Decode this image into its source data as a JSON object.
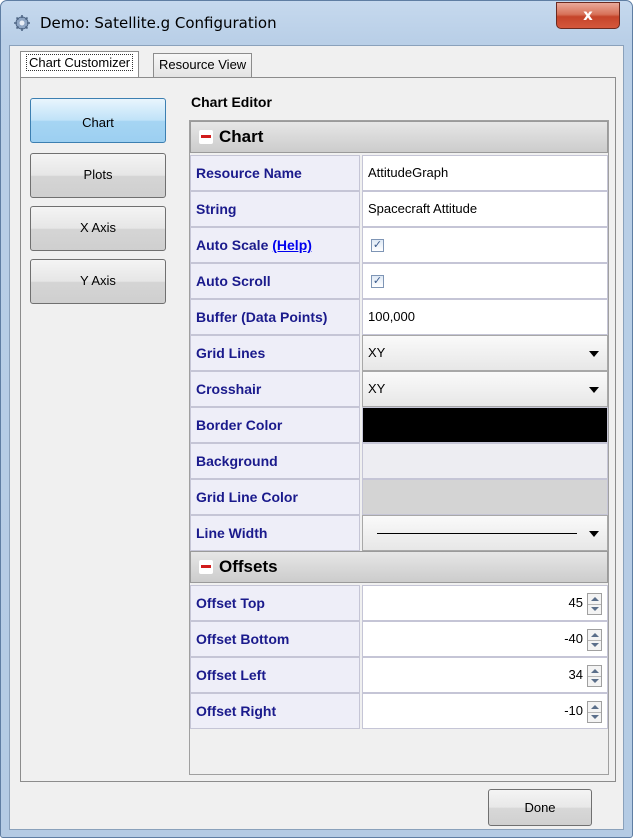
{
  "window": {
    "title": "Demo: Satellite.g Configuration",
    "close_glyph": "x"
  },
  "tabs": [
    {
      "label": "Chart Customizer",
      "active": true
    },
    {
      "label": "Resource View",
      "active": false
    }
  ],
  "nav": [
    {
      "label": "Chart",
      "selected": true
    },
    {
      "label": "Plots",
      "selected": false
    },
    {
      "label": "X Axis",
      "selected": false
    },
    {
      "label": "Y Axis",
      "selected": false
    }
  ],
  "editor": {
    "title": "Chart Editor",
    "chart_section": {
      "title": "Chart",
      "resource_name": {
        "label": "Resource Name",
        "value": "AttitudeGraph"
      },
      "string": {
        "label": "String",
        "value": "Spacecraft Attitude"
      },
      "auto_scale": {
        "label": "Auto Scale",
        "help": "(Help)",
        "checked": true
      },
      "auto_scroll": {
        "label": "Auto Scroll",
        "checked": true
      },
      "buffer": {
        "label": "Buffer (Data Points)",
        "value": "100,000"
      },
      "grid_lines": {
        "label": "Grid Lines",
        "value": "XY"
      },
      "crosshair": {
        "label": "Crosshair",
        "value": "XY"
      },
      "border_color": {
        "label": "Border Color",
        "color": "#000000"
      },
      "background": {
        "label": "Background",
        "color": "#ededf2"
      },
      "grid_line_color": {
        "label": "Grid Line Color",
        "color": "#d4d4d4"
      },
      "line_width": {
        "label": "Line Width"
      }
    },
    "offsets_section": {
      "title": "Offsets",
      "top": {
        "label": "Offset Top",
        "value": "45"
      },
      "bottom": {
        "label": "Offset Bottom",
        "value": "-40"
      },
      "left": {
        "label": "Offset Left",
        "value": "34"
      },
      "right": {
        "label": "Offset Right",
        "value": "-10"
      }
    }
  },
  "footer": {
    "done_label": "Done"
  },
  "icons": {
    "title": "gear-satellite-icon",
    "checkbox": "checkmark-icon",
    "dropdown": "chevron-down-icon",
    "collapse": "minus-icon",
    "spinner": "up-down-arrows-icon"
  },
  "colors": {
    "label_text": "#1a1a8c",
    "nav_selected": "#a6d5f3",
    "close_button": "#c5442a"
  }
}
